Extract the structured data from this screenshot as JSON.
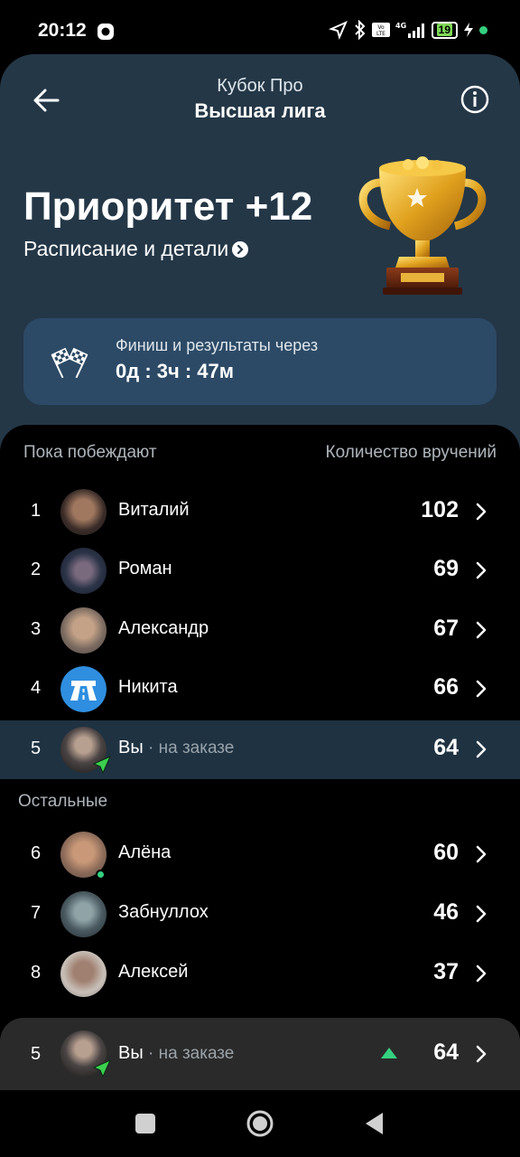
{
  "status_bar": {
    "time": "20:12",
    "battery": "19",
    "network": "4G"
  },
  "header": {
    "subtitle": "Кубок Про",
    "title": "Высшая лига",
    "priority": "Приоритет +12",
    "schedule_link": "Расписание и детали",
    "finish_label": "Финиш и результаты через",
    "finish_time": "0д : 3ч : 47м"
  },
  "board": {
    "winners_heading": "Пока побеждают",
    "count_heading": "Количество вручений",
    "others_heading": "Остальные",
    "winners": [
      {
        "rank": "1",
        "name": "Виталий",
        "score": "102"
      },
      {
        "rank": "2",
        "name": "Роман",
        "score": "69"
      },
      {
        "rank": "3",
        "name": "Александр",
        "score": "67"
      },
      {
        "rank": "4",
        "name": "Никита",
        "score": "66"
      },
      {
        "rank": "5",
        "name": "Вы",
        "suffix": " · на заказе",
        "score": "64"
      }
    ],
    "others": [
      {
        "rank": "6",
        "name": "Алёна",
        "score": "60"
      },
      {
        "rank": "7",
        "name": "Забнуллох",
        "score": "46"
      },
      {
        "rank": "8",
        "name": "Алексей",
        "score": "37"
      }
    ]
  },
  "sticky_row": {
    "rank": "5",
    "name": "Вы",
    "suffix": " · на заказе",
    "score": "64"
  },
  "colors": {
    "header_bg": "#243747",
    "finish_bg": "#2c4a66",
    "highlight_row": "#1e3242",
    "accent_green": "#35d07f",
    "sticky_bg": "#2a2a2a"
  }
}
